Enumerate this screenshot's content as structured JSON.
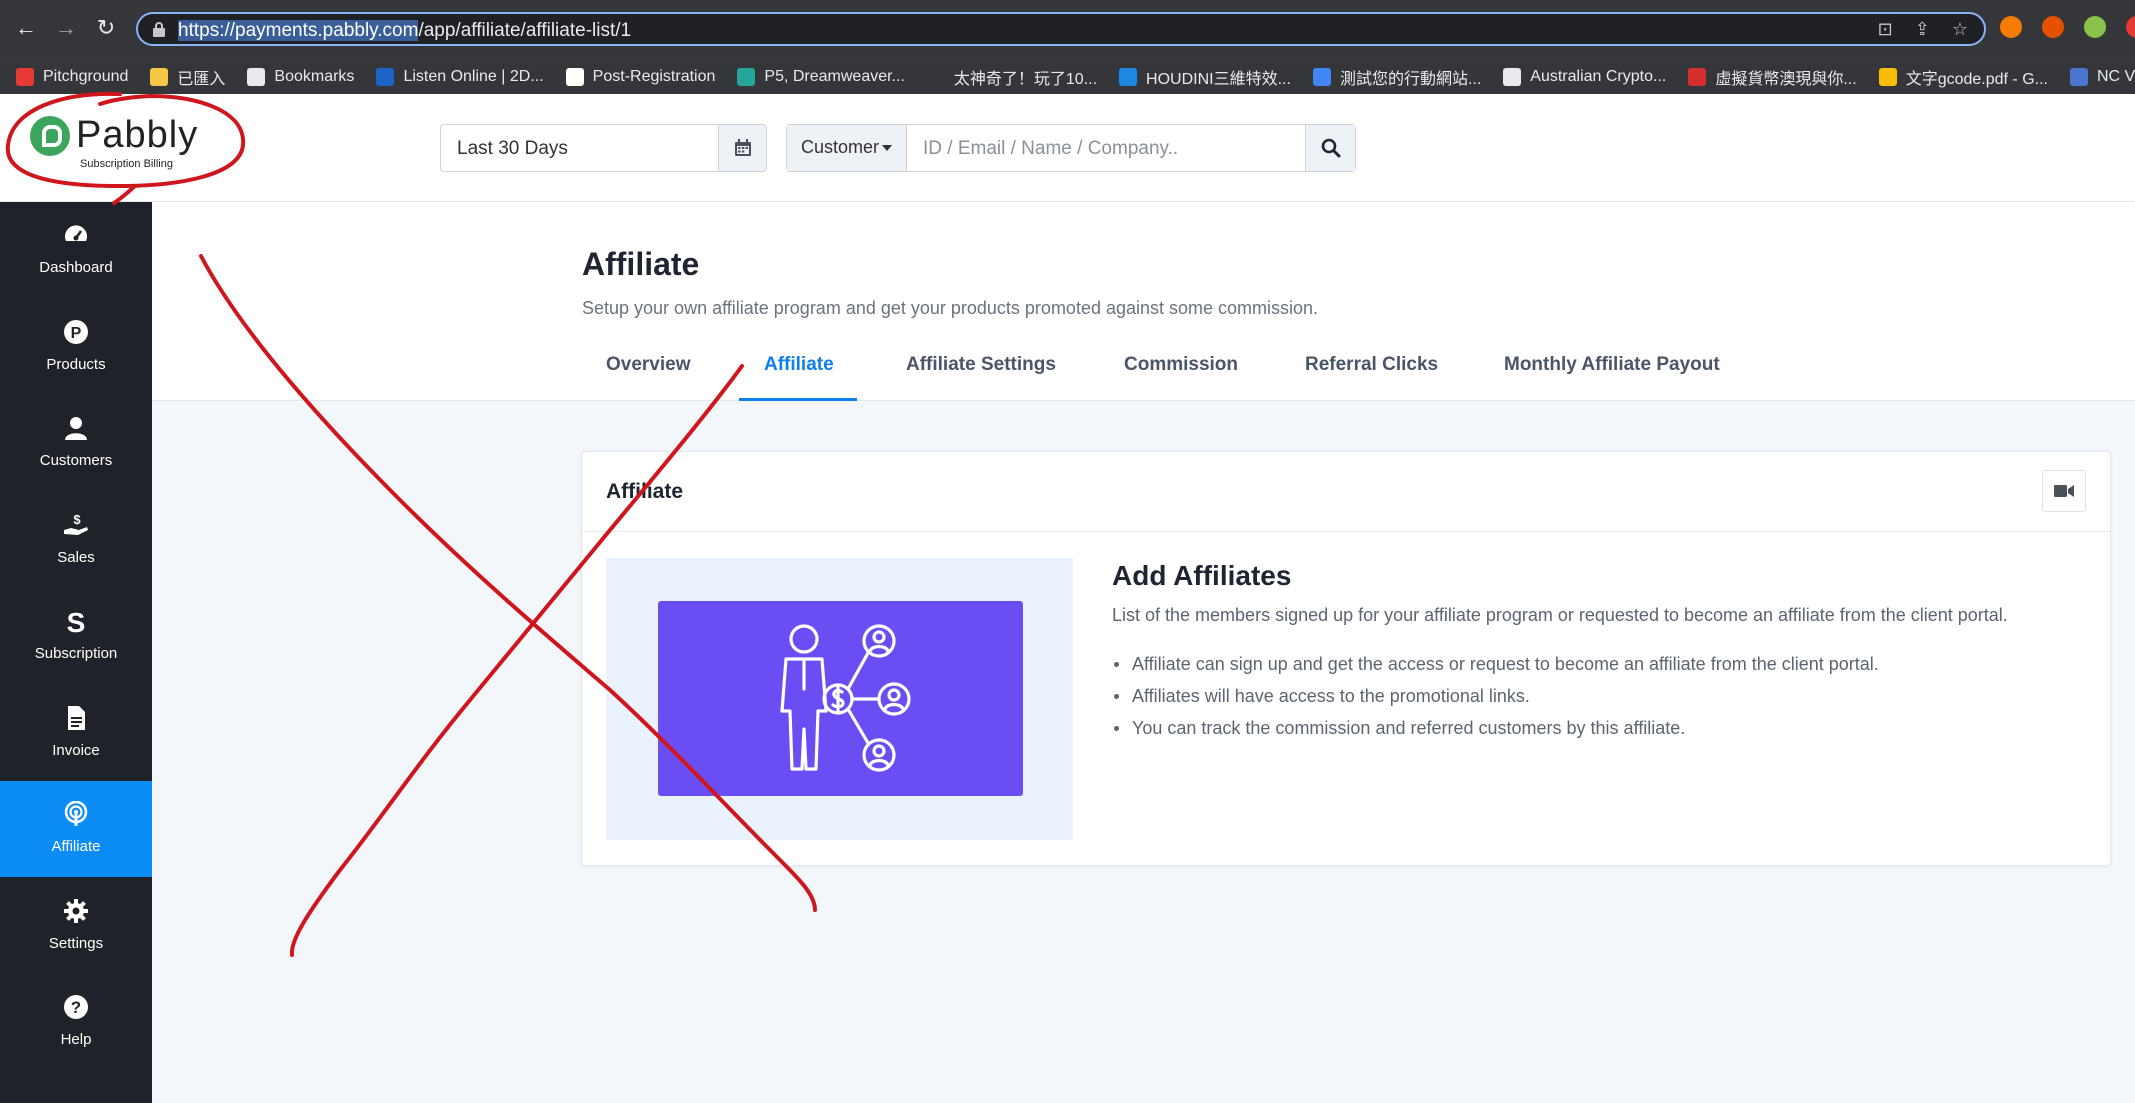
{
  "browser": {
    "url_host": "https://payments.pabbly.com",
    "url_path": "/app/affiliate/affiliate-list/1",
    "bookmarks": [
      {
        "label": "Pitchground",
        "color": "#e53935"
      },
      {
        "label": "已匯入",
        "color": "#f6c744"
      },
      {
        "label": "Bookmarks",
        "color": "#e8eaed"
      },
      {
        "label": "Listen Online | 2D...",
        "color": "#1e63c7"
      },
      {
        "label": "Post-Registration",
        "color": "#ffffff"
      },
      {
        "label": "P5, Dreamweaver...",
        "color": "#26a69a"
      },
      {
        "label": "太神奇了！玩了10...",
        "color": "#35363a"
      },
      {
        "label": "HOUDINI三維特效...",
        "color": "#1e88e5"
      },
      {
        "label": "測試您的行動網站...",
        "color": "#4285f4"
      },
      {
        "label": "Australian Crypto...",
        "color": "#e8eaed"
      },
      {
        "label": "虛擬貨幣澳現與你...",
        "color": "#d32f2f"
      },
      {
        "label": "文字gcode.pdf - G...",
        "color": "#fbbc04"
      },
      {
        "label": "NC Viewer",
        "color": "#4a76d0"
      }
    ]
  },
  "header": {
    "logo_name": "Pabbly",
    "logo_sub": "Subscription Billing",
    "date_range": "Last 30 Days",
    "search_filter": "Customer",
    "search_placeholder": "ID / Email / Name / Company.."
  },
  "sidebar": {
    "items": [
      {
        "label": "Dashboard",
        "icon": "dashboard-icon"
      },
      {
        "label": "Products",
        "icon": "products-icon"
      },
      {
        "label": "Customers",
        "icon": "user-icon"
      },
      {
        "label": "Sales",
        "icon": "hand-dollar-icon"
      },
      {
        "label": "Subscription",
        "icon": "dollar-icon"
      },
      {
        "label": "Invoice",
        "icon": "file-icon"
      },
      {
        "label": "Affiliate",
        "icon": "broadcast-icon"
      },
      {
        "label": "Settings",
        "icon": "gear-icon"
      },
      {
        "label": "Help",
        "icon": "help-icon"
      }
    ],
    "active": "Affiliate"
  },
  "page": {
    "title": "Affiliate",
    "description": "Setup your own affiliate program and get your products promoted against some commission.",
    "tabs": [
      "Overview",
      "Affiliate",
      "Affiliate Settings",
      "Commission",
      "Referral Clicks",
      "Monthly Affiliate Payout"
    ],
    "active_tab": "Affiliate"
  },
  "card": {
    "title": "Affiliate",
    "info_title": "Add Affiliates",
    "info_desc": "List of the members signed up for your affiliate program or requested to become an affiliate from the client portal.",
    "bullets": [
      "Affiliate can sign up and get the access or request to become an affiliate from the client portal.",
      "Affiliates will have access to the promotional links.",
      "You can track the commission and referred customers by this affiliate."
    ]
  },
  "colors": {
    "accent": "#0c8cf5",
    "sidebar_bg": "#1f2329",
    "illustration_bg": "#6a4ef3",
    "annotation_red": "#d0161d"
  }
}
